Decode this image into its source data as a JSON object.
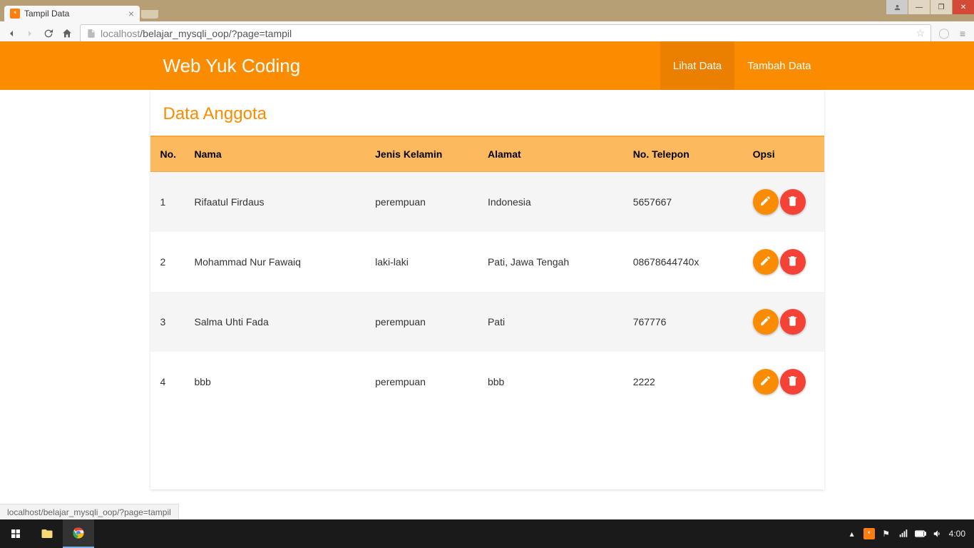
{
  "browser": {
    "tab_title": "Tampil Data",
    "url_host": "localhost",
    "url_path": "/belajar_mysqli_oop/?page=tampil",
    "hover_link": "localhost/belajar_mysqli_oop/?page=tampil"
  },
  "navbar": {
    "brand": "Web Yuk Coding",
    "links": [
      {
        "label": "Lihat Data",
        "active": true
      },
      {
        "label": "Tambah Data",
        "active": false
      }
    ]
  },
  "page": {
    "heading": "Data Anggota"
  },
  "table": {
    "headers": {
      "no": "No.",
      "nama": "Nama",
      "jk": "Jenis Kelamin",
      "alamat": "Alamat",
      "tel": "No. Telepon",
      "opsi": "Opsi"
    },
    "rows": [
      {
        "no": "1",
        "nama": "Rifaatul Firdaus",
        "jk": "perempuan",
        "alamat": "Indonesia",
        "tel": "5657667"
      },
      {
        "no": "2",
        "nama": "Mohammad Nur Fawaiq",
        "jk": "laki-laki",
        "alamat": "Pati, Jawa Tengah",
        "tel": "08678644740x"
      },
      {
        "no": "3",
        "nama": "Salma Uhti Fada",
        "jk": "perempuan",
        "alamat": "Pati",
        "tel": "767776"
      },
      {
        "no": "4",
        "nama": "bbb",
        "jk": "perempuan",
        "alamat": "bbb",
        "tel": "2222"
      }
    ]
  },
  "taskbar": {
    "clock": "4:00"
  }
}
